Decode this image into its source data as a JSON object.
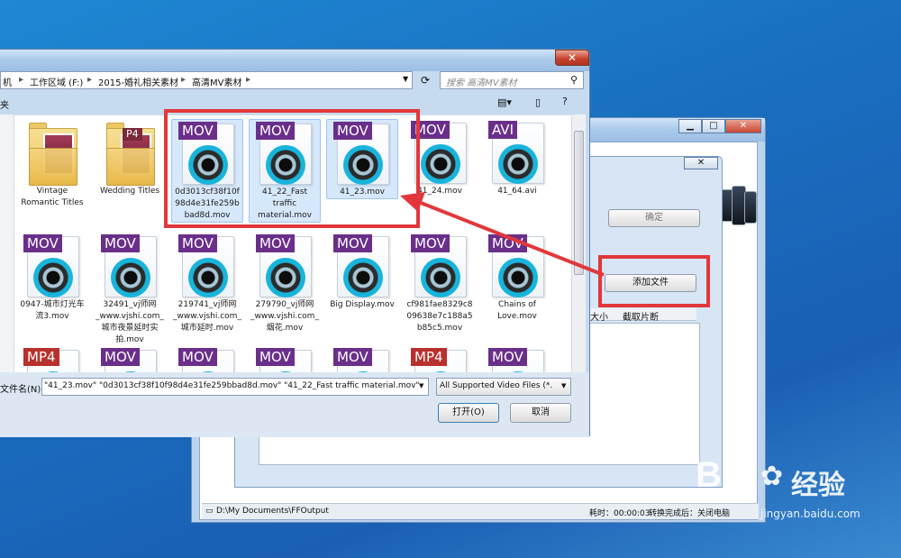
{
  "file_dialog": {
    "breadcrumb": [
      "机",
      "工作区域 (F:)",
      "2015-婚礼相关素材",
      "高清MV素材"
    ],
    "search_placeholder": "搜索 高清MV素材",
    "toolbar_label": "夹",
    "filename_label": "文件名(N):",
    "filename_value": "\"41_23.mov\" \"0d3013cf38f10f98d4e31fe259bbad8d.mov\" \"41_22_Fast traffic material.mov\"",
    "filetype_value": "All Supported Video Files (*.",
    "open_button": "打开(O)",
    "cancel_button": "取消",
    "close_glyph": "✕",
    "items": [
      {
        "type": "folder",
        "name": "Vintage Romantic Titles",
        "lines": [
          "Vintage",
          "Romantic Titles"
        ],
        "selected": false
      },
      {
        "type": "folder",
        "name": "Wedding Titles",
        "lines": [
          "Wedding Titles"
        ],
        "selected": false,
        "badge": "P4"
      },
      {
        "type": "mov",
        "badge": "MOV",
        "lines": [
          "0d3013cf38f10f",
          "98d4e31fe259b",
          "bad8d.mov"
        ],
        "selected": true
      },
      {
        "type": "mov",
        "badge": "MOV",
        "lines": [
          "41_22_Fast",
          "traffic",
          "material.mov"
        ],
        "selected": true
      },
      {
        "type": "mov",
        "badge": "MOV",
        "lines": [
          "41_23.mov"
        ],
        "selected": true
      },
      {
        "type": "mov",
        "badge": "MOV",
        "lines": [
          "41_24.mov"
        ],
        "selected": false
      },
      {
        "type": "avi",
        "badge": "AVI",
        "lines": [
          "41_64.avi"
        ],
        "selected": false
      },
      {
        "type": "mov",
        "badge": "MOV",
        "lines": [
          "0947-城市灯光车",
          "流3.mov"
        ],
        "selected": false
      },
      {
        "type": "mov",
        "badge": "MOV",
        "lines": [
          "32491_vj师网",
          "_www.vjshi.com_",
          "城市夜景延时实",
          "拍.mov"
        ],
        "selected": false
      },
      {
        "type": "mov",
        "badge": "MOV",
        "lines": [
          "219741_vj师网",
          "_www.vjshi.com_",
          "城市延时.mov"
        ],
        "selected": false
      },
      {
        "type": "mov",
        "badge": "MOV",
        "lines": [
          "279790_vj师网",
          "_www.vjshi.com_",
          "烟花.mov"
        ],
        "selected": false
      },
      {
        "type": "mov",
        "badge": "MOV",
        "lines": [
          "Big Display.mov"
        ],
        "selected": false
      },
      {
        "type": "mov",
        "badge": "MOV",
        "lines": [
          "cf981fae8329c8",
          "09638e7c188a5",
          "b85c5.mov"
        ],
        "selected": false
      },
      {
        "type": "mov",
        "badge": "MOV",
        "lines": [
          "Chains of",
          "Love.mov"
        ],
        "selected": false
      },
      {
        "type": "mp4",
        "badge": "MP4",
        "lines": [],
        "selected": false
      },
      {
        "type": "mov",
        "badge": "MOV",
        "lines": [],
        "selected": false
      },
      {
        "type": "mov",
        "badge": "MOV",
        "lines": [],
        "selected": false
      },
      {
        "type": "mov",
        "badge": "MOV",
        "lines": [],
        "selected": false
      },
      {
        "type": "mov",
        "badge": "MOV",
        "lines": [],
        "selected": false
      },
      {
        "type": "mp4",
        "badge": "MP4",
        "lines": [],
        "selected": false
      },
      {
        "type": "mov",
        "badge": "MOV",
        "lines": [],
        "selected": false
      }
    ]
  },
  "app": {
    "confirm_button": "确定",
    "add_file_button": "添加文件",
    "col_size": "大小",
    "col_clip": "截取片断",
    "output_path": "D:\\My Documents\\FFOutput",
    "elapsed": "耗时：00:00:03",
    "after_convert": "转换完成后：关闭电脑",
    "min_glyph": "▁",
    "max_glyph": "□",
    "close_glyph": "✕"
  },
  "watermark": {
    "brand": "Bai",
    "brand_tail": "经验",
    "url": "jingyan.baidu.com"
  }
}
